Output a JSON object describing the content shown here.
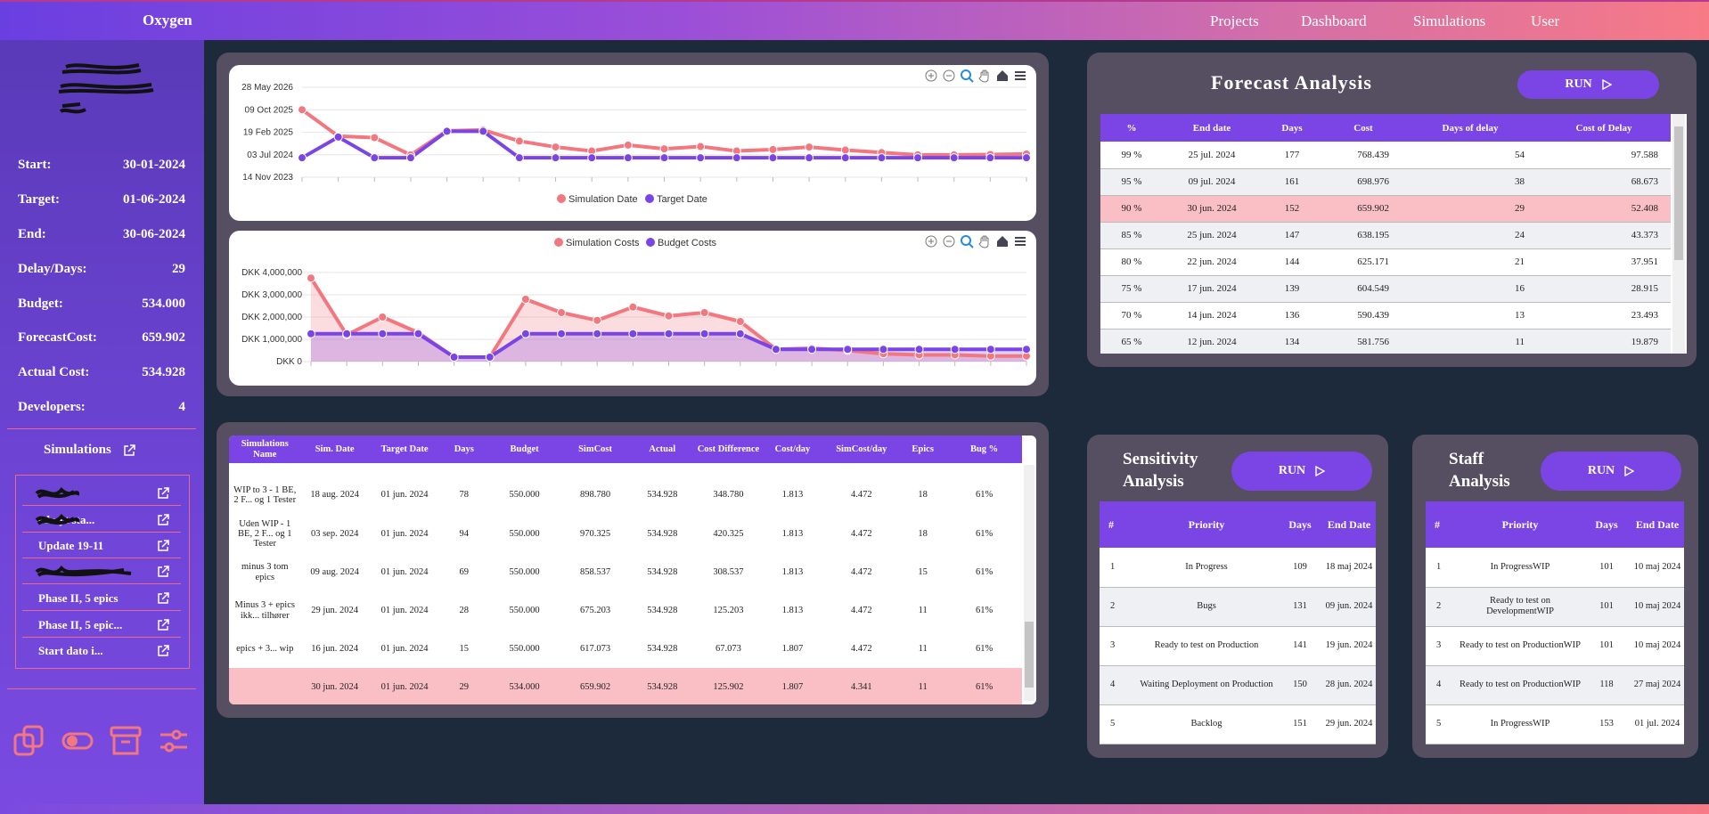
{
  "app": {
    "title": "Oxygen",
    "nav": [
      "Projects",
      "Dashboard",
      "Simulations",
      "User"
    ]
  },
  "sidebar": {
    "stats": [
      {
        "label": "Start:",
        "value": "30-01-2024"
      },
      {
        "label": "Target:",
        "value": "01-06-2024"
      },
      {
        "label": "End:",
        "value": "30-06-2024"
      },
      {
        "label": "Delay/Days:",
        "value": "29"
      },
      {
        "label": "Budget:",
        "value": "534.000"
      },
      {
        "label": "ForecastCost:",
        "value": "659.902"
      },
      {
        "label": "Actual Cost:",
        "value": "534.928"
      },
      {
        "label": "Developers:",
        "value": "4"
      }
    ],
    "simulations_title": "Simulations",
    "simulations": [
      "",
      "ed nyt sta...",
      "Update 19-11",
      "",
      "Phase II, 5 epics",
      "Phase II, 5 epic...",
      "Start dato i..."
    ]
  },
  "date_chart": {
    "y_ticks": [
      "28 May 2026",
      "09 Oct 2025",
      "19 Feb 2025",
      "03 Jul 2024",
      "14 Nov 2023"
    ],
    "legend": [
      "Simulation Date",
      "Target Date"
    ],
    "colors": {
      "sim": "#f2777f",
      "target": "#7b45e6"
    }
  },
  "cost_chart": {
    "y_ticks": [
      "DKK 4,000,000",
      "DKK 3,000,000",
      "DKK 2,000,000",
      "DKK 1,000,000",
      "DKK 0"
    ],
    "legend": [
      "Simulation Costs",
      "Budget Costs"
    ]
  },
  "chart_data": [
    {
      "type": "line",
      "y_tick_labels": [
        "28 May 2026",
        "09 Oct 2025",
        "19 Feb 2025",
        "03 Jul 2024",
        "14 Nov 2023"
      ],
      "series": [
        {
          "name": "Simulation Date",
          "values": [
            "2025-10-09",
            "2025-01-10",
            "2024-12-25",
            "2024-07-01",
            "2025-03-05",
            "2025-03-15",
            "2024-11-20",
            "2024-09-20",
            "2024-08-10",
            "2024-10-10",
            "2024-09-01",
            "2024-09-25",
            "2024-08-10",
            "2024-08-25",
            "2024-09-20",
            "2024-08-20",
            "2024-07-25",
            "2024-07-01",
            "2024-07-01",
            "2024-07-05",
            "2024-07-10"
          ]
        },
        {
          "name": "Target Date",
          "values": [
            "2024-06-01",
            "2025-01-01",
            "2024-06-01",
            "2024-06-01",
            "2025-03-01",
            "2025-03-01",
            "2024-06-01",
            "2024-06-01",
            "2024-06-01",
            "2024-06-01",
            "2024-06-01",
            "2024-06-01",
            "2024-06-01",
            "2024-06-01",
            "2024-06-01",
            "2024-06-01",
            "2024-06-01",
            "2024-06-01",
            "2024-06-01",
            "2024-06-01",
            "2024-06-01"
          ]
        }
      ]
    },
    {
      "type": "area",
      "ylim": [
        0,
        4000000
      ],
      "y_tick_labels": [
        "DKK 4,000,000",
        "DKK 3,000,000",
        "DKK 2,000,000",
        "DKK 1,000,000",
        "DKK 0"
      ],
      "series": [
        {
          "name": "Simulation Costs",
          "values": [
            3750000,
            1200000,
            2000000,
            1300000,
            200000,
            200000,
            2800000,
            2200000,
            1850000,
            2450000,
            2050000,
            2200000,
            1800000,
            550000,
            600000,
            500000,
            350000,
            300000,
            300000,
            250000,
            250000
          ]
        },
        {
          "name": "Budget Costs",
          "values": [
            1250000,
            1250000,
            1250000,
            1250000,
            200000,
            200000,
            1250000,
            1250000,
            1250000,
            1250000,
            1250000,
            1250000,
            1250000,
            550000,
            550000,
            550000,
            550000,
            550000,
            550000,
            550000,
            550000
          ]
        }
      ]
    }
  ],
  "sim_table": {
    "headers": [
      "Simulations Name",
      "Sim. Date",
      "Target Date",
      "Days",
      "Budget",
      "SimCost",
      "Actual",
      "Cost Difference",
      "Cost/day",
      "SimCost/day",
      "Epics",
      "Bug %"
    ],
    "rows": [
      [
        "WIP to 3 - 1 BE, 2 F... og 1 Tester",
        "18 aug. 2024",
        "01 jun. 2024",
        "78",
        "550.000",
        "898.780",
        "534.928",
        "348.780",
        "1.813",
        "4.472",
        "18",
        "61%"
      ],
      [
        "Uden WIP - 1 BE, 2 F... og 1 Tester",
        "03 sep. 2024",
        "01 jun. 2024",
        "94",
        "550.000",
        "970.325",
        "534.928",
        "420.325",
        "1.813",
        "4.472",
        "18",
        "61%"
      ],
      [
        "minus 3 tom epics",
        "09 aug. 2024",
        "01 jun. 2024",
        "69",
        "550.000",
        "858.537",
        "534.928",
        "308.537",
        "1.813",
        "4.472",
        "15",
        "61%"
      ],
      [
        "Minus 3 + epics ikk... tilhører",
        "29 jun. 2024",
        "01 jun. 2024",
        "28",
        "550.000",
        "675.203",
        "534.928",
        "125.203",
        "1.813",
        "4.472",
        "11",
        "61%"
      ],
      [
        "epics + 3... wip",
        "16 jun. 2024",
        "01 jun. 2024",
        "15",
        "550.000",
        "617.073",
        "534.928",
        "67.073",
        "1.807",
        "4.472",
        "11",
        "61%"
      ],
      [
        "",
        "30 jun. 2024",
        "01 jun. 2024",
        "29",
        "534.000",
        "659.902",
        "534.928",
        "125.902",
        "1.807",
        "4.341",
        "11",
        "61%"
      ]
    ]
  },
  "forecast": {
    "title": "Forecast Analysis",
    "run_label": "RUN",
    "headers": [
      "%",
      "End date",
      "Days",
      "Cost",
      "Days of delay",
      "Cost of Delay"
    ],
    "rows": [
      [
        "99 %",
        "25 jul. 2024",
        "177",
        "768.439",
        "54",
        "97.588"
      ],
      [
        "95 %",
        "09 jul. 2024",
        "161",
        "698.976",
        "38",
        "68.673"
      ],
      [
        "90 %",
        "30 jun. 2024",
        "152",
        "659.902",
        "29",
        "52.408"
      ],
      [
        "85 %",
        "25 jun. 2024",
        "147",
        "638.195",
        "24",
        "43.373"
      ],
      [
        "80 %",
        "22 jun. 2024",
        "144",
        "625.171",
        "21",
        "37.951"
      ],
      [
        "75 %",
        "17 jun. 2024",
        "139",
        "604.549",
        "16",
        "28.915"
      ],
      [
        "70 %",
        "14 jun. 2024",
        "136",
        "590.439",
        "13",
        "23.493"
      ],
      [
        "65 %",
        "12 jun. 2024",
        "134",
        "581.756",
        "11",
        "19.879"
      ]
    ]
  },
  "sensitivity": {
    "title_line1": "Sensitivity",
    "title_line2": "Analysis",
    "run_label": "RUN",
    "headers": [
      "#",
      "Priority",
      "Days",
      "End Date"
    ],
    "rows": [
      [
        "1",
        "In Progress",
        "109",
        "18 maj 2024"
      ],
      [
        "2",
        "Bugs",
        "131",
        "09 jun. 2024"
      ],
      [
        "3",
        "Ready to test on Production",
        "141",
        "19 jun. 2024"
      ],
      [
        "4",
        "Waiting Deployment on Production",
        "150",
        "28 jun. 2024"
      ],
      [
        "5",
        "Backlog",
        "151",
        "29 jun. 2024"
      ]
    ]
  },
  "staff": {
    "title_line1": "Staff",
    "title_line2": "Analysis",
    "run_label": "RUN",
    "headers": [
      "#",
      "Priority",
      "Days",
      "End Date"
    ],
    "rows": [
      [
        "1",
        "In ProgressWIP",
        "101",
        "10 maj 2024"
      ],
      [
        "2",
        "Ready to test on DevelopmentWIP",
        "101",
        "10 maj 2024"
      ],
      [
        "3",
        "Ready to test on ProductionWIP",
        "101",
        "10 maj 2024"
      ],
      [
        "4",
        "Ready to test on ProductionWIP",
        "118",
        "27 maj 2024"
      ],
      [
        "5",
        "In ProgressWIP",
        "153",
        "01 jul. 2024"
      ]
    ]
  }
}
